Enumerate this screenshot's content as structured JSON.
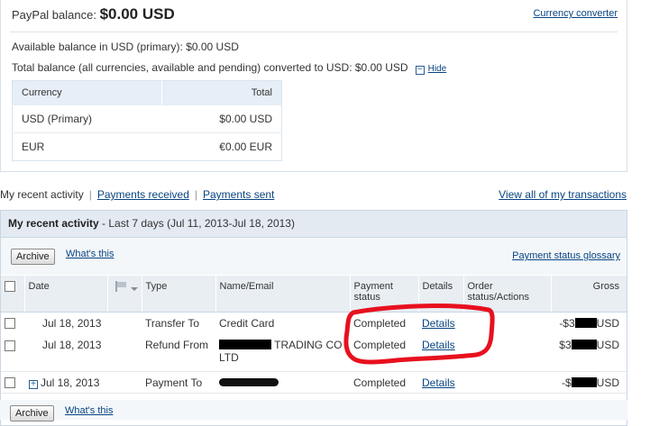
{
  "balance": {
    "title_label": "PayPal balance:",
    "title_amount": "$0.00 USD",
    "currency_converter": "Currency converter",
    "available_line": "Available balance in USD (primary): $0.00 USD",
    "total_line": "Total balance (all currencies, available and pending) converted to USD: $0.00 USD",
    "hide_label": "Hide",
    "table": {
      "headers": [
        "Currency",
        "Total"
      ],
      "rows": [
        {
          "currency": "USD (Primary)",
          "total": "$0.00 USD"
        },
        {
          "currency": "EUR",
          "total": "€0.00 EUR"
        }
      ]
    }
  },
  "tabs": {
    "current": "My recent activity",
    "received": "Payments received",
    "sent": "Payments sent",
    "view_all": "View all of my transactions"
  },
  "activity": {
    "heading": "My recent activity",
    "range": " - Last 7 days (Jul 11, 2013-Jul 18, 2013)",
    "archive": "Archive",
    "whats_this": "What's this",
    "glossary": "Payment status glossary",
    "columns": {
      "date": "Date",
      "type": "Type",
      "name": "Name/Email",
      "status": "Payment status",
      "details": "Details",
      "order": "Order status/Actions",
      "gross": "Gross"
    },
    "rows": [
      {
        "date": "Jul 18, 2013",
        "type": "Transfer To",
        "name": "Credit Card",
        "status": "Completed",
        "details": "Details",
        "gross_prefix": "-$3",
        "gross_suffix": "USD"
      },
      {
        "date": "Jul 18, 2013",
        "type": "Refund From",
        "name_visible": "TRADING CO",
        "name_line2": "LTD",
        "status": "Completed",
        "details": "Details",
        "gross_prefix": "$3",
        "gross_suffix": "USD"
      },
      {
        "date": "Jul 18, 2013",
        "type": "Payment To",
        "status": "Completed",
        "details": "Details",
        "gross_prefix": "-$",
        "gross_suffix": "USD"
      }
    ]
  },
  "colors": {
    "link": "#084482",
    "header_bg": "#e3eaf2",
    "annotation_red": "#e8101e"
  }
}
